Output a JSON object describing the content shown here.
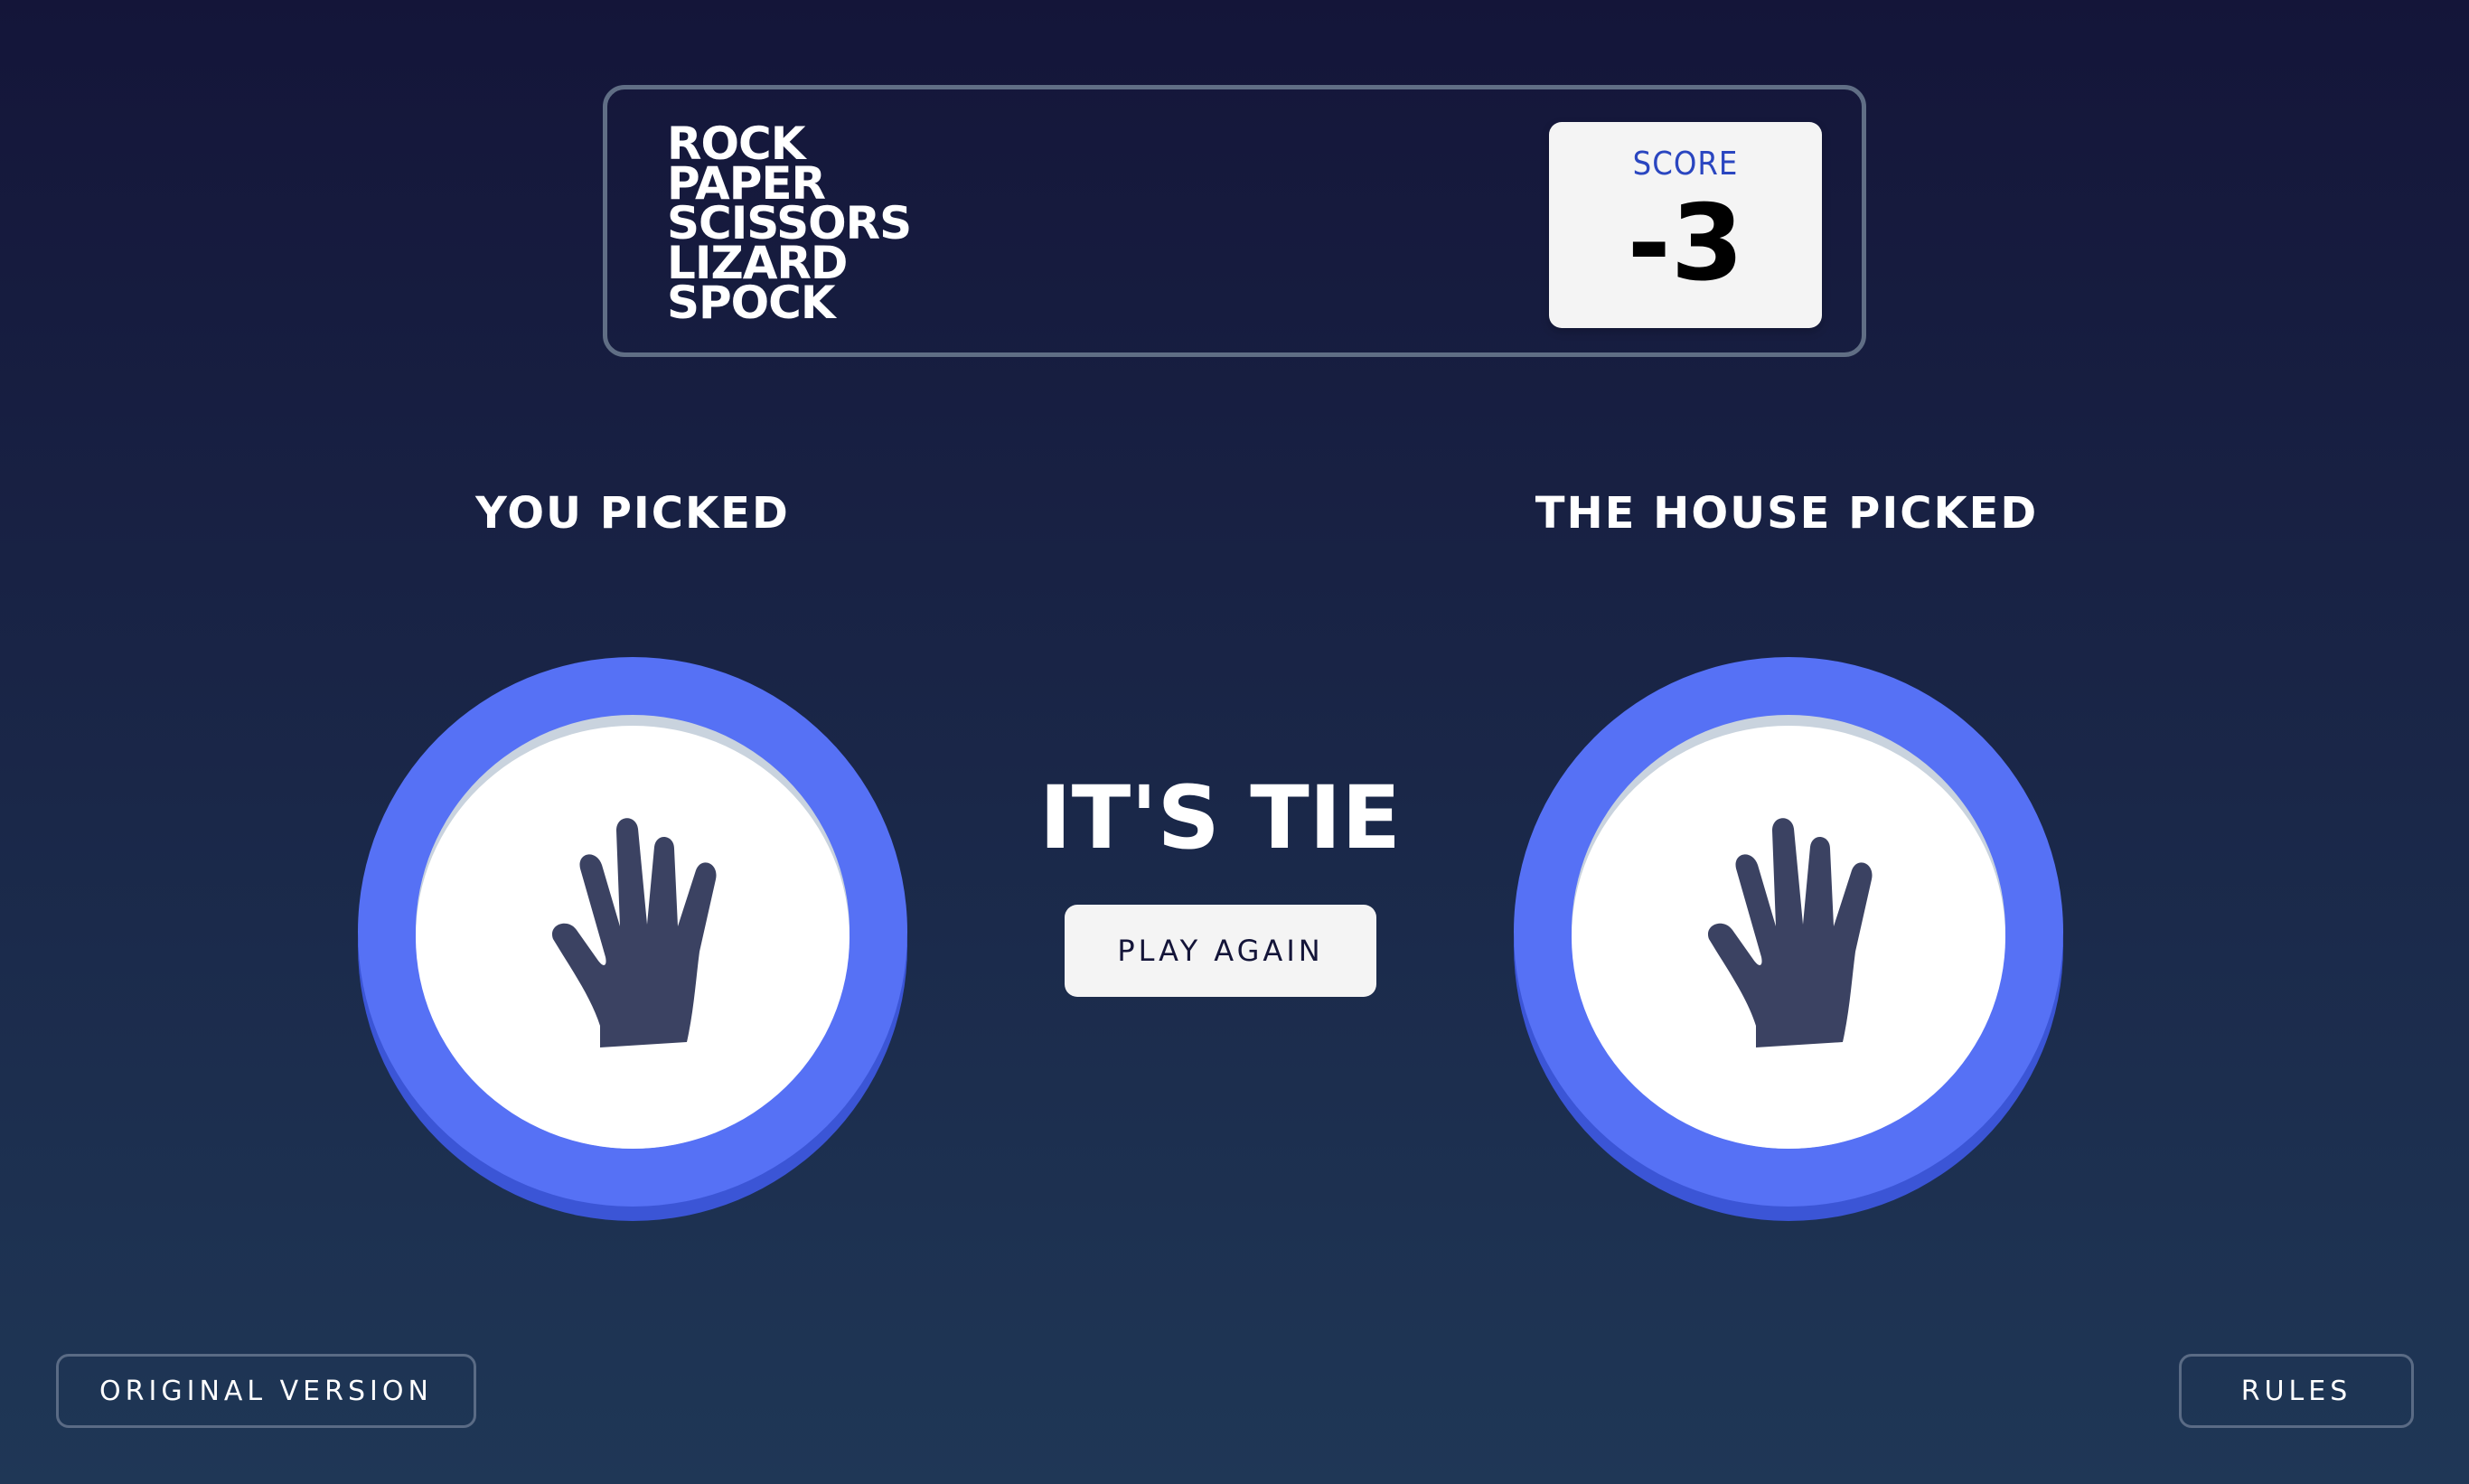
{
  "header": {
    "title_lines": [
      "ROCK",
      "PAPER",
      "SCISSORS",
      "LIZARD",
      "SPOCK"
    ],
    "score_label": "SCORE",
    "score_value": "-3"
  },
  "player": {
    "heading": "YOU PICKED",
    "choice": "paper",
    "icon": "hand-paper-icon",
    "ring_color": "#5671f5"
  },
  "house": {
    "heading": "THE HOUSE PICKED",
    "choice": "paper",
    "icon": "hand-paper-icon",
    "ring_color": "#5671f5"
  },
  "result": {
    "text": "IT'S TIE",
    "play_again_label": "PLAY AGAIN"
  },
  "footer": {
    "original_version_label": "ORIGINAL VERSION",
    "rules_label": "RULES"
  },
  "colors": {
    "background_top": "#141539",
    "background_bottom": "#1f3756",
    "header_outline": "#606e85",
    "score_label": "#2a46c0",
    "paper_ring": "#5671f5",
    "paper_ring_shadow": "#3b55d6",
    "icon_fill": "#3b4262"
  }
}
